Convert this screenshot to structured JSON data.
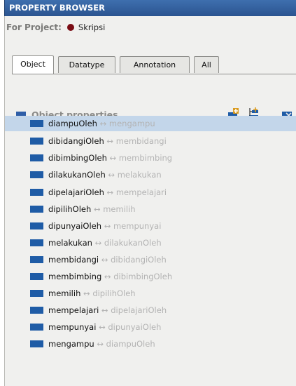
{
  "header": {
    "title": "PROPERTY BROWSER"
  },
  "project": {
    "label": "For Project:",
    "name": "Skripsi"
  },
  "tabs": [
    {
      "label": "Object",
      "active": true
    },
    {
      "label": "Datatype",
      "active": false
    },
    {
      "label": "Annotation",
      "active": false
    },
    {
      "label": "All",
      "active": false
    }
  ],
  "section": {
    "title": "Object properties"
  },
  "toolbar": {
    "icons": [
      "add-property-icon",
      "add-subproperty-icon",
      "delete-property-icon"
    ]
  },
  "properties": [
    {
      "name": "diampuOleh",
      "arrow": "↔",
      "inverse": "mengampu",
      "selected": true
    },
    {
      "name": "dibidangiOleh",
      "arrow": "↔",
      "inverse": "membidangi"
    },
    {
      "name": "dibimbingOleh",
      "arrow": "↔",
      "inverse": "membimbing"
    },
    {
      "name": "dilakukanOleh",
      "arrow": "↔",
      "inverse": "melakukan"
    },
    {
      "name": "dipelajariOleh",
      "arrow": "↔",
      "inverse": "mempelajari"
    },
    {
      "name": "dipilihOleh",
      "arrow": "↔",
      "inverse": "memilih"
    },
    {
      "name": "dipunyaiOleh",
      "arrow": "↔",
      "inverse": "mempunyai"
    },
    {
      "name": "melakukan",
      "arrow": "↔",
      "inverse": "dilakukanOleh"
    },
    {
      "name": "membidangi",
      "arrow": "↔",
      "inverse": "dibidangiOleh"
    },
    {
      "name": "membimbing",
      "arrow": "↔",
      "inverse": "dibimbingOleh"
    },
    {
      "name": "memilih",
      "arrow": "↔",
      "inverse": "dipilihOleh"
    },
    {
      "name": "mempelajari",
      "arrow": "↔",
      "inverse": "dipelajariOleh"
    },
    {
      "name": "mempunyai",
      "arrow": "↔",
      "inverse": "dipunyaiOleh"
    },
    {
      "name": "mengampu",
      "arrow": "↔",
      "inverse": "diampuOleh"
    }
  ],
  "colors": {
    "title_bar": "#2b5490",
    "property_icon": "#1f5ca6",
    "selection": "#c3d6ea",
    "project_dot": "#7a0c14"
  }
}
